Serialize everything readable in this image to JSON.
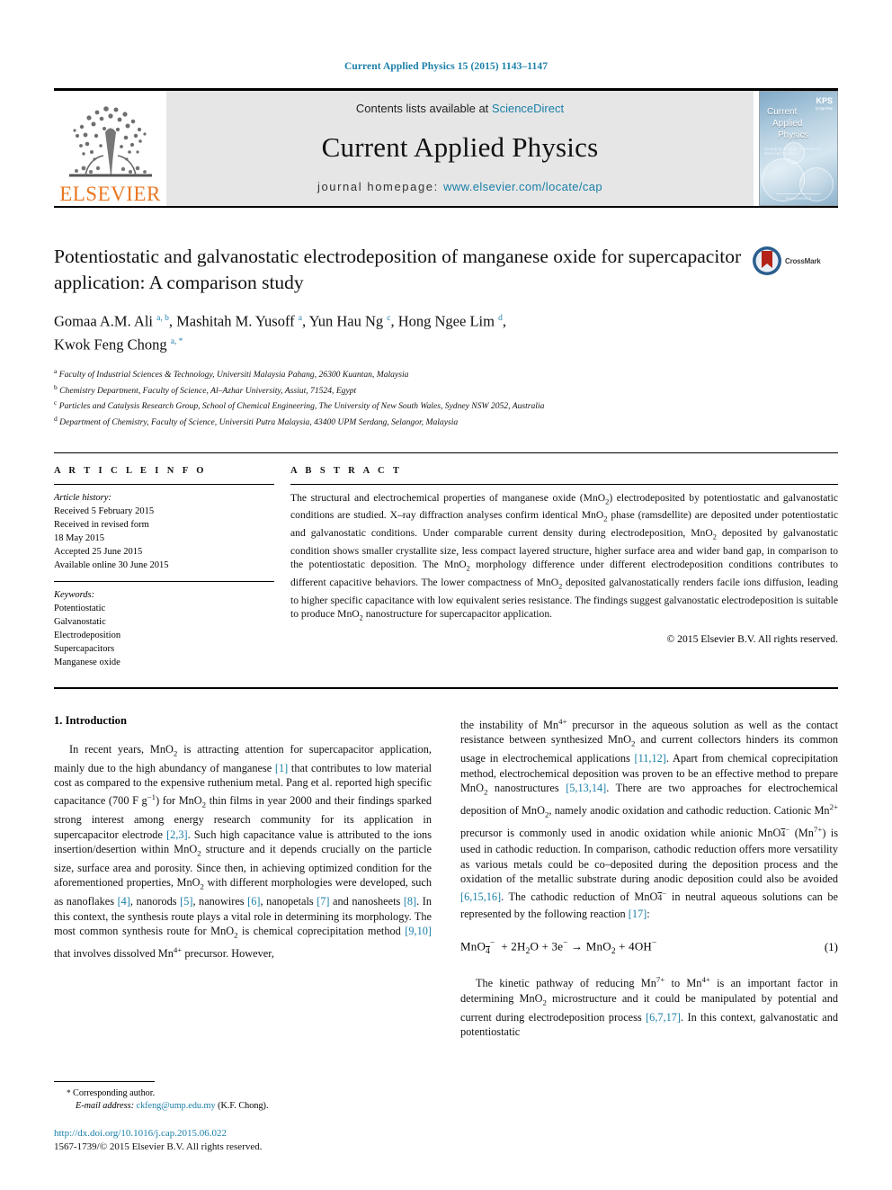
{
  "running_head": "Current Applied Physics 15 (2015) 1143–1147",
  "masthead": {
    "contents_prefix": "Contents lists available at ",
    "sciencedirect": "ScienceDirect",
    "journal_title": "Current Applied Physics",
    "homepage_label": "journal homepage:",
    "homepage_url": "www.elsevier.com/locate/cap",
    "publisher_logo_text": "ELSEVIER",
    "cover": {
      "line1": "Current",
      "line2": "Applied",
      "line3": "Physics",
      "subtitle": "Including Critical Reviews of Materials Science",
      "badge": "KPS",
      "badge_sub": "한국물리학회",
      "footer": "ScienceDirect"
    },
    "accent_color": "#1a7fa8",
    "elsevier_orange": "#E87722"
  },
  "article": {
    "title": "Potentiostatic and galvanostatic electrodeposition of manganese oxide for supercapacitor application: A comparison study",
    "crossmark_label": "CrossMark",
    "authors_line1": "Gomaa A.M. Ali a, b, Mashitah M. Yusoff a, Yun Hau Ng c, Hong Ngee Lim d,",
    "authors_line2": "Kwok Feng Chong a, *",
    "affiliations": [
      "a Faculty of Industrial Sciences & Technology, Universiti Malaysia Pahang, 26300 Kuantan, Malaysia",
      "b Chemistry Department, Faculty of Science, Al-Azhar University, Assiut, 71524, Egypt",
      "c Particles and Catalysis Research Group, School of Chemical Engineering, The University of New South Wales, Sydney NSW 2052, Australia",
      "d Department of Chemistry, Faculty of Science, Universiti Putra Malaysia, 43400 UPM Serdang, Selangor, Malaysia"
    ]
  },
  "article_info": {
    "heading": "A R T I C L E  I N F O",
    "history_label": "Article history:",
    "history": [
      "Received 5 February 2015",
      "Received in revised form",
      "18 May 2015",
      "Accepted 25 June 2015",
      "Available online 30 June 2015"
    ],
    "keywords_label": "Keywords:",
    "keywords": [
      "Potentiostatic",
      "Galvanostatic",
      "Electrodeposition",
      "Supercapacitors",
      "Manganese oxide"
    ]
  },
  "abstract": {
    "heading": "A B S T R A C T",
    "text": "The structural and electrochemical properties of manganese oxide (MnO2) electrodeposited by potentiostatic and galvanostatic conditions are studied. X–ray diffraction analyses confirm identical MnO2 phase (ramsdellite) are deposited under potentiostatic and galvanostatic conditions. Under comparable current density during electrodeposition, MnO2 deposited by galvanostatic condition shows smaller crystallite size, less compact layered structure, higher surface area and wider band gap, in comparison to the potentiostatic deposition. The MnO2 morphology difference under different electrodeposition conditions contributes to different capacitive behaviors. The lower compactness of MnO2 deposited galvanostatically renders facile ions diffusion, leading to higher specific capacitance with low equivalent series resistance. The findings suggest galvanostatic electrodeposition is suitable to produce MnO2 nanostructure for supercapacitor application.",
    "copyright": "© 2015 Elsevier B.V. All rights reserved."
  },
  "body": {
    "section_heading": "1.  Introduction",
    "left_paragraph": "In recent years, MnO2 is attracting attention for supercapacitor application, mainly due to the high abundancy of manganese [1] that contributes to low material cost as compared to the expensive ruthenium metal. Pang et al. reported high specific capacitance (700 F g−1) for MnO2 thin films in year 2000 and their findings sparked strong interest among energy research community for its application in supercapacitor electrode [2,3]. Such high capacitance value is attributed to the ions insertion/desertion within MnO2 structure and it depends crucially on the particle size, surface area and porosity. Since then, in achieving optimized condition for the aforementioned properties, MnO2 with different morphologies were developed, such as nanoflakes [4], nanorods [5], nanowires [6], nanopetals [7] and nanosheets [8]. In this context, the synthesis route plays a vital role in determining its morphology. The most common synthesis route for MnO2 is chemical coprecipitation method [9,10] that involves dissolved Mn4+ precursor. However,",
    "right_paragraph_1": "the instability of Mn4+ precursor in the aqueous solution as well as the contact resistance between synthesized MnO2 and current collectors hinders its common usage in electrochemical applications [11,12]. Apart from chemical coprecipitation method, electrochemical deposition was proven to be an effective method to prepare MnO2 nanostructures [5,13,14]. There are two approaches for electrochemical deposition of MnO2, namely anodic oxidation and cathodic reduction. Cationic Mn2+ precursor is commonly used in anodic oxidation while anionic MnO4− (Mn7+) is used in cathodic reduction. In comparison, cathodic reduction offers more versatility as various metals could be co-deposited during the deposition process and the oxidation of the metallic substrate during anodic deposition could also be avoided [6,15,16]. The cathodic reduction of MnO4− in neutral aqueous solutions can be represented by the following reaction [17]:",
    "equation": "MnO4− + 2H2O + 3e− → MnO2 + 4OH−",
    "equation_number": "(1)",
    "right_paragraph_2": "The kinetic pathway of reducing Mn7+ to Mn4+ is an important factor in determining MnO2 microstructure and it could be manipulated by potential and current during electrodeposition process [6,7,17]. In this context, galvanostatic and potentiostatic"
  },
  "footnotes": {
    "corresponding_marker": "*",
    "corresponding_text": "Corresponding author.",
    "email_label": "E-mail address:",
    "email": "ckfeng@ump.edu.my",
    "email_owner": "(K.F. Chong).",
    "doi": "http://dx.doi.org/10.1016/j.cap.2015.06.022",
    "issn_line": "1567-1739/© 2015 Elsevier B.V. All rights reserved."
  }
}
